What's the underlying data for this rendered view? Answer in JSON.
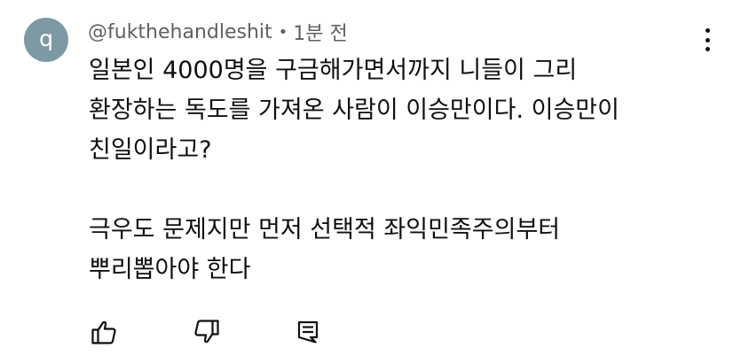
{
  "comment": {
    "avatar_letter": "q",
    "avatar_color": "#7e99a6",
    "username": "@fukthehandleshit",
    "separator": "•",
    "timestamp": "1분 전",
    "lines": [
      "일본인 4000명을 구금해가면서까지 니들이 그리",
      "환장하는 독도를 가져온 사람이 이승만이다. 이승만이",
      "친일이라고?",
      "극우도 문제지만 먼저 선택적 좌익민족주의부터",
      "뿌리뽑아야 한다"
    ]
  },
  "actions": {
    "like_icon": "thumb-up-icon",
    "dislike_icon": "thumb-down-icon",
    "reply_icon": "reply-icon"
  },
  "menu_icon": "more-vertical-icon"
}
